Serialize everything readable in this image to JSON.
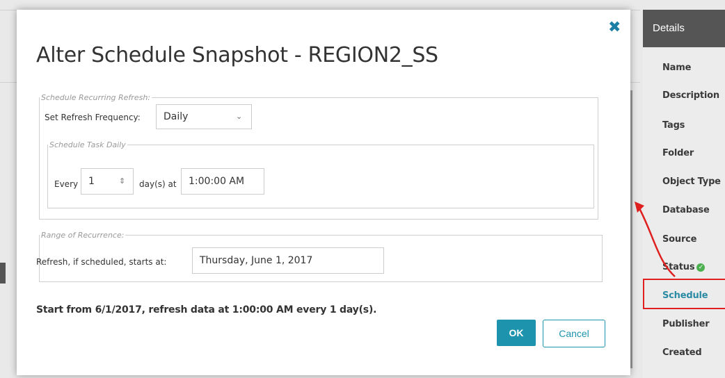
{
  "dialog": {
    "title": "Alter Schedule Snapshot - REGION2_SS",
    "close_icon": "close-icon",
    "recurring_legend": "Schedule Recurring Refresh:",
    "frequency_label": "Set Refresh Frequency:",
    "frequency_value": "Daily",
    "daily_legend": "Schedule Task Daily",
    "every_label": "Every",
    "every_value": "1",
    "days_at_label": "day(s) at",
    "time_value": "1:00:00 AM",
    "range_legend": "Range of Recurrence:",
    "starts_label": "Refresh, if scheduled, starts at:",
    "start_date_value": "Thursday, June 1, 2017",
    "summary": "Start from 6/1/2017, refresh data at 1:00:00 AM every 1 day(s).",
    "ok_label": "OK",
    "cancel_label": "Cancel"
  },
  "details": {
    "header": "Details",
    "items": [
      "Name",
      "Description",
      "Tags",
      "Folder",
      "Object Type",
      "Database",
      "Source",
      "Status",
      "Schedule",
      "Publisher",
      "Created"
    ],
    "active_item": "Schedule"
  },
  "colors": {
    "accent": "#1e93ad",
    "annotation": "#e02020",
    "status_ok": "#4caf50"
  }
}
